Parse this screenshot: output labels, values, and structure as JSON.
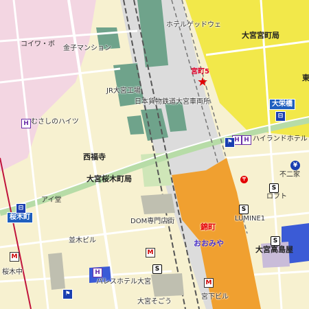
{
  "map": {
    "colors": {
      "background": "#f7f1d0",
      "commercial": "#f2e84a",
      "residential_pink": "#f3d6e2",
      "park_green": "#cfe6b8",
      "building_green": "#6fa38b",
      "station_orange": "#f0a030",
      "rail_gray": "#c8c8c8",
      "road": "#ffffff",
      "major_road_green": "#b7dca7",
      "water_blue": "#3b5bd6"
    },
    "labels": {
      "hotel_gateway": "ホテルゲッドウェ",
      "omiya_miyamachi": "大宮宮町局",
      "kinko": "コイワ・ボ",
      "kaneko_mansion": "金子マンション",
      "miyamachi5": "宮町5",
      "east_edge": "東",
      "jr_factory": "JR大宮工場",
      "freight_station": "日本貨物鉄道大宮車両所",
      "omiya_bridge": "大栄橋",
      "musashi_heights": "むさしのハイツ",
      "hotel_hi": "ハイランドホテル",
      "saifukuji": "西福寺",
      "sakuragicho_post": "大宮桜木町局",
      "fujiya": "不二家",
      "tsutaya": "アイ堂",
      "rofto": "ロフト",
      "sakuragicho_box": "桜木町",
      "dom_shop": "DOM専門店街",
      "nishiki": "錦町",
      "lumine": "LUMINE1",
      "oomiya_kana": "おおみや",
      "namiki_building": "並木ビル",
      "omiya_takashimaya": "大宮高島屋",
      "sakuragi_jr": "桜木中",
      "palace_hotel": "パレスホテル大宮",
      "omiya_sogo": "大宮そごう",
      "miyashita_building": "宮下ビル"
    }
  }
}
